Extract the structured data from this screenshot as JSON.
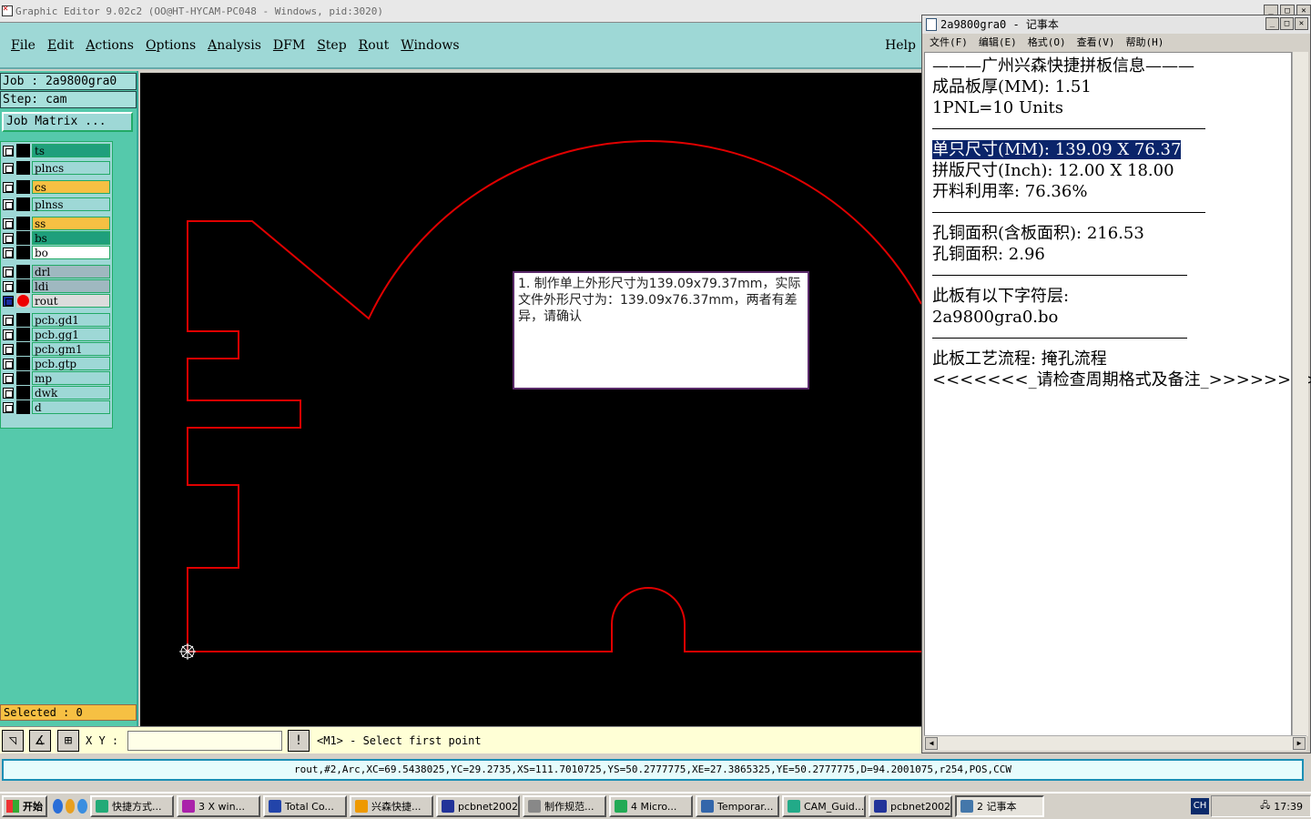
{
  "ge_window": {
    "title": "Graphic Editor 9.02c2 (OO@HT-HYCAM-PC048 - Windows, pid:3020)",
    "menus": [
      "File",
      "Edit",
      "Actions",
      "Options",
      "Analysis",
      "DFM",
      "Step",
      "Rout",
      "Windows"
    ],
    "help": "Help"
  },
  "sidebar": {
    "job": "Job : 2a9800gra0",
    "step": "Step: cam",
    "job_matrix": "Job Matrix ...",
    "layers": [
      {
        "name": "ts",
        "color": "#1f9f7c"
      },
      {
        "name": "plncs",
        "color": "#9ed8d6"
      },
      {
        "name": "cs",
        "color": "#f6c043",
        "flag": "✐"
      },
      {
        "name": "plnss",
        "color": "#9ed8d6"
      },
      {
        "name": "ss",
        "color": "#f6c043"
      },
      {
        "name": "bs",
        "color": "#1f9f7c",
        "flag": "✐"
      },
      {
        "name": "bo",
        "color": "#ffffff"
      },
      {
        "name": "drl",
        "color": "#9fb8c0"
      },
      {
        "name": "ldi",
        "color": "#9fb8c0"
      },
      {
        "name": "rout",
        "color": "#dcdcdc",
        "flag": "▣",
        "active": true
      },
      {
        "name": "pcb.gd1",
        "color": "#9ed8d6",
        "flag": "✐"
      },
      {
        "name": "pcb.gg1",
        "color": "#9ed8d6",
        "flag": "✐"
      },
      {
        "name": "pcb.gm1",
        "color": "#9ed8d6"
      },
      {
        "name": "pcb.gtp",
        "color": "#9ed8d6"
      },
      {
        "name": "mp",
        "color": "#9ed8d6"
      },
      {
        "name": "dwk",
        "color": "#9ed8d6"
      },
      {
        "name": "d",
        "color": "#9ed8d6"
      }
    ],
    "selected": "Selected : 0"
  },
  "popup": {
    "text": "1. 制作单上外形尺寸为139.09x79.37mm，实际文件外形尺寸为：139.09x76.37mm，两者有差异，请确认"
  },
  "bottombar": {
    "xy_label": "X Y :",
    "xy_value": "",
    "prompt": "<M1> - Select first point"
  },
  "status_line": "rout,#2,Arc,XC=69.5438025,YC=29.2735,XS=111.7010725,YS=50.2777775,XE=27.3865325,YE=50.2777775,D=94.2001075,r254,POS,CCW",
  "notepad": {
    "title": "2a9800gra0 - 记事本",
    "menus": [
      "文件(F)",
      "编辑(E)",
      "格式(O)",
      "查看(V)",
      "帮助(H)"
    ],
    "lines": [
      "———广州兴森快捷拼板信息———",
      "成品板厚(MM): 1.51",
      "1PNL=10 Units",
      "",
      "单只尺寸(MM): 139.09 X 76.37",
      "拼版尺寸(Inch): 12.00 X 18.00",
      "开料利用率: 76.36%",
      "",
      "孔铜面积(含板面积): 216.53",
      "孔铜面积: 2.96",
      "",
      "此板有以下字符层:",
      "2a9800gra0.bo",
      "",
      "此板工艺流程: 掩孔流程",
      "<<<<<<<_请检查周期格式及备注_>>>>>>>>"
    ]
  },
  "taskbar": {
    "start": "开始",
    "tasks": [
      {
        "label": "快捷方式...",
        "icon_color": "#2a7"
      },
      {
        "label": "3 X win...",
        "icon_color": "#a2a"
      },
      {
        "label": "Total Co...",
        "icon_color": "#24a"
      },
      {
        "label": "兴森快捷...",
        "icon_color": "#e90"
      },
      {
        "label": "pcbnet2002",
        "icon_color": "#239"
      },
      {
        "label": "制作规范...",
        "icon_color": "#888"
      },
      {
        "label": "4 Micro...",
        "icon_color": "#2a5"
      },
      {
        "label": "Temporar...",
        "icon_color": "#36a"
      },
      {
        "label": "CAM_Guid...",
        "icon_color": "#2a8"
      },
      {
        "label": "pcbnet2002",
        "icon_color": "#239"
      },
      {
        "label": "2 记事本",
        "icon_color": "#47a",
        "active": true
      }
    ],
    "ime": "CH",
    "clock": "17:39"
  }
}
